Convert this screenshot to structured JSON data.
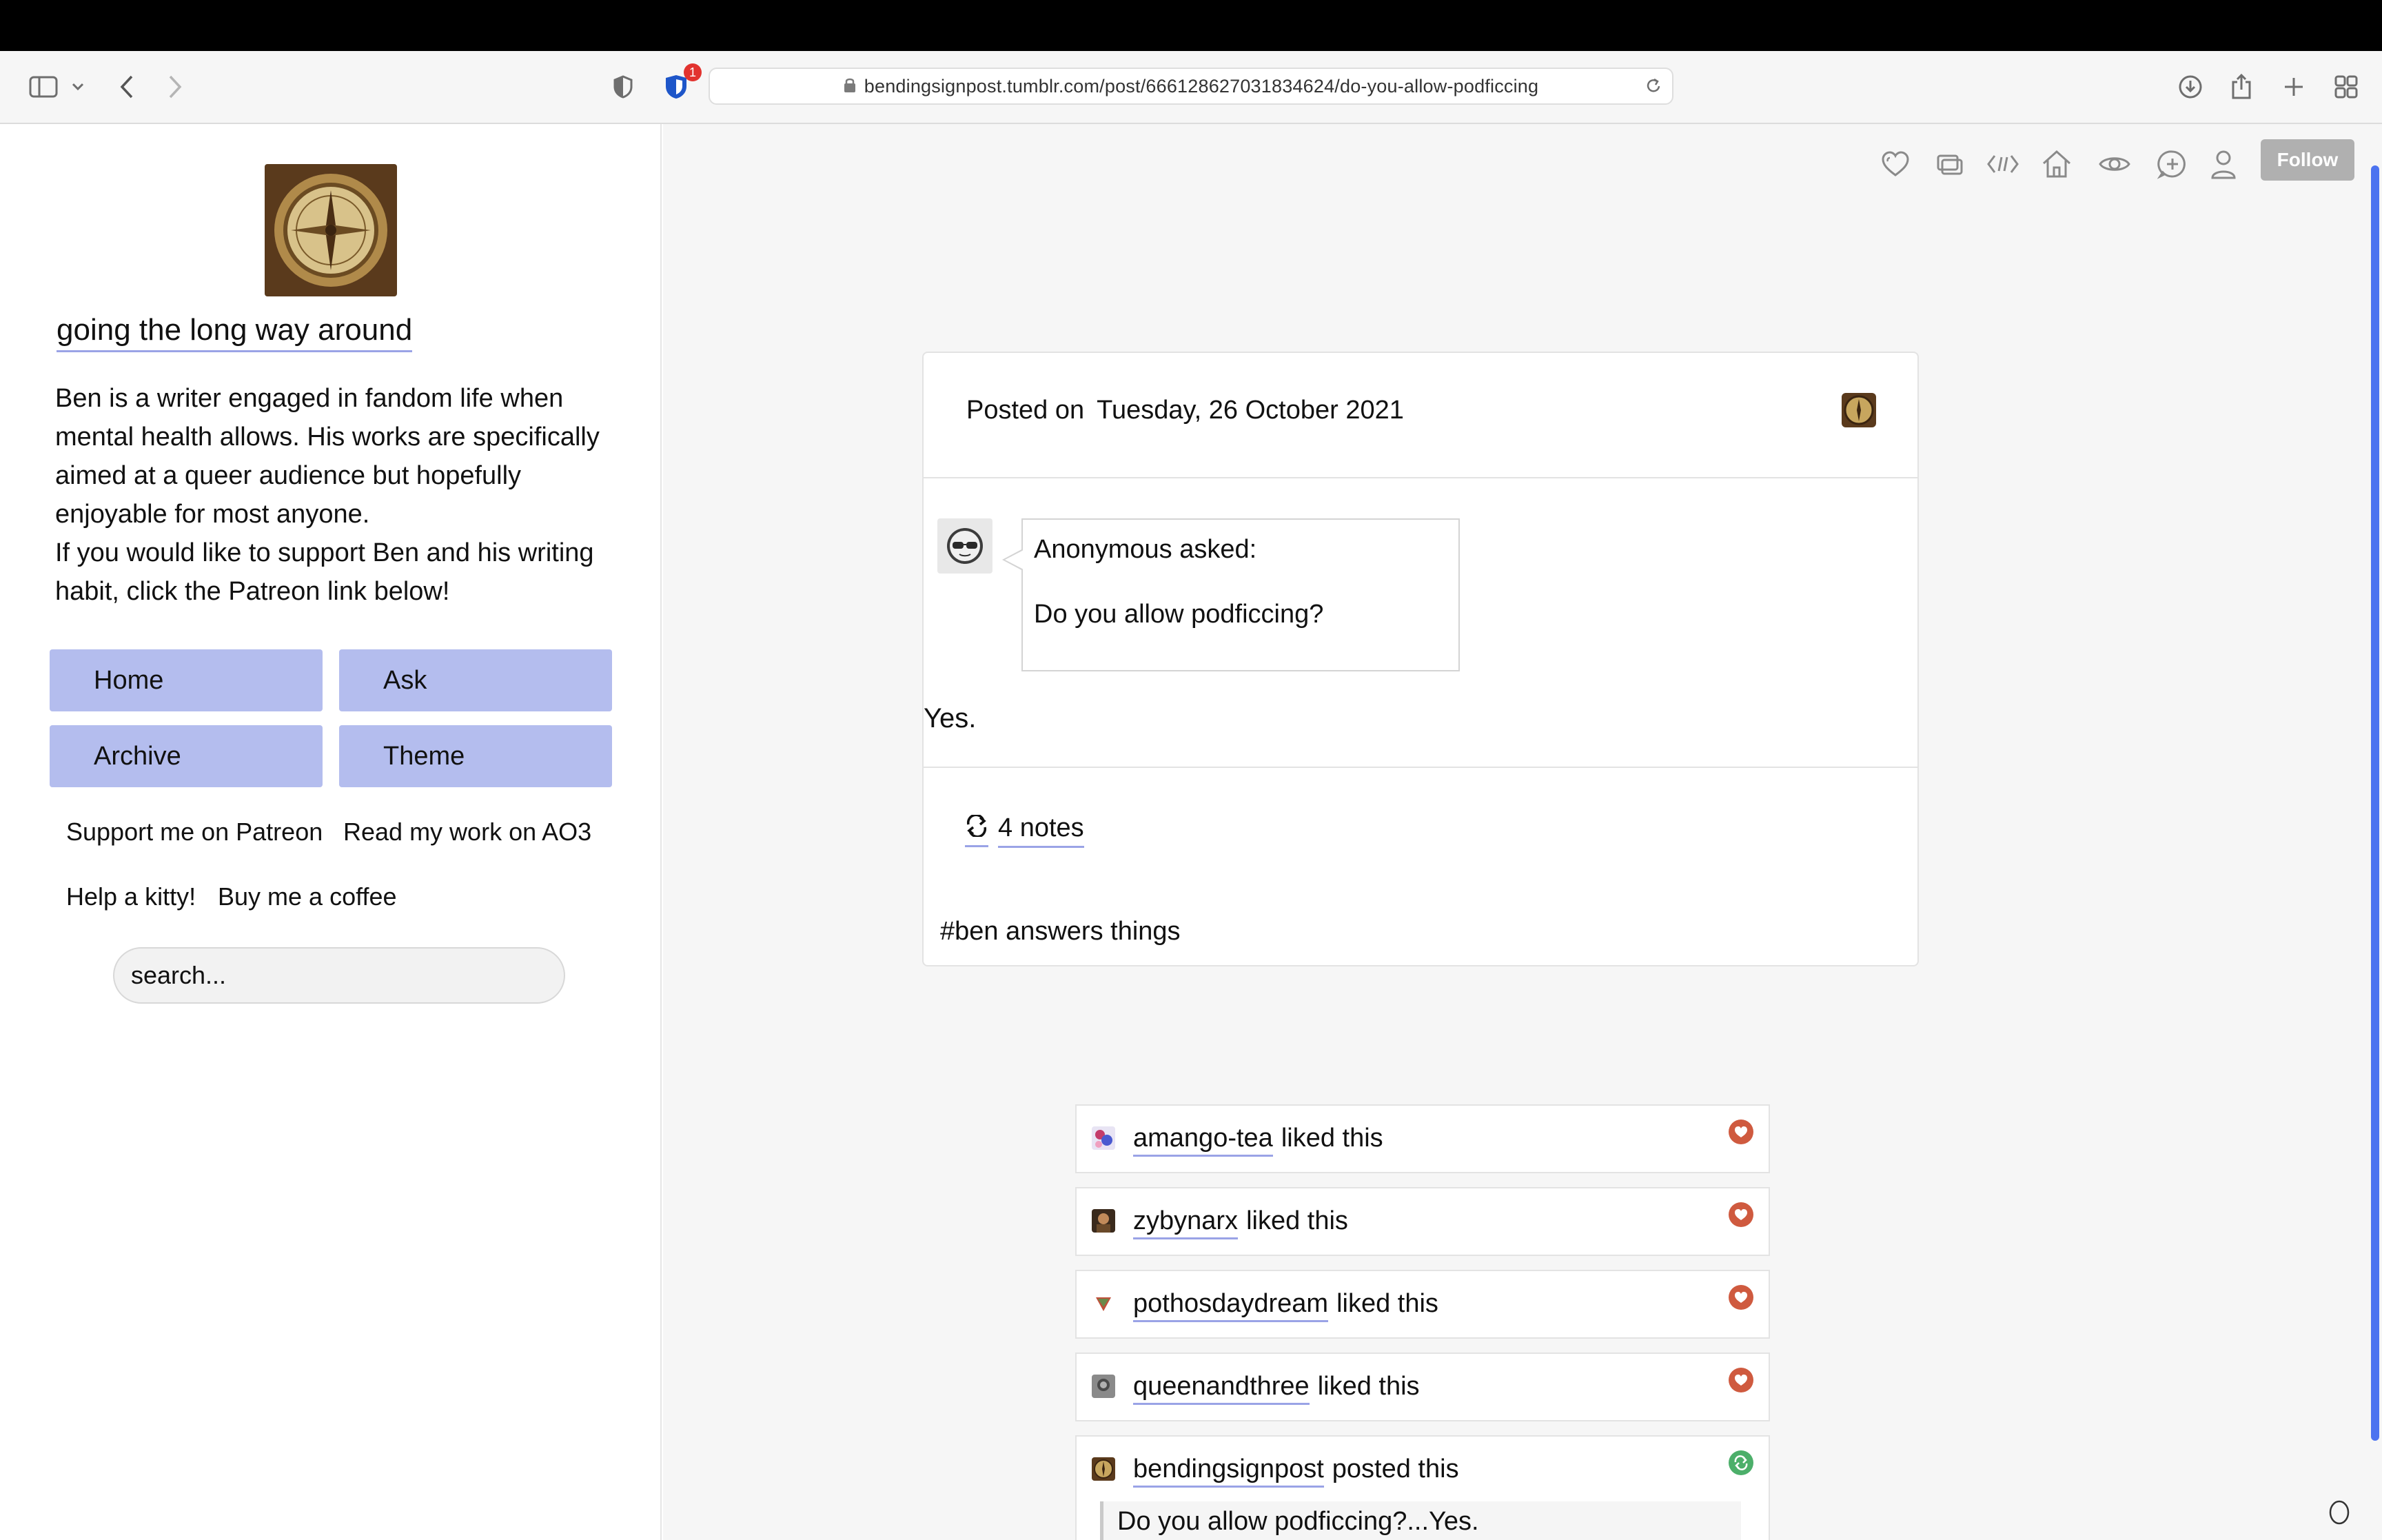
{
  "browser": {
    "url": "bendingsignpost.tumblr.com/post/666128627031834624/do-you-allow-podficcing",
    "extension_badge": "1"
  },
  "sidebar": {
    "blog_title": "going the long way around",
    "description": "Ben is a writer engaged in fandom life when mental health allows. His works are specifically aimed at a queer audience but hopefully enjoyable for most anyone.\nIf you would like to support Ben and his writing habit, click the Patreon link below!",
    "nav": {
      "home": "Home",
      "ask": "Ask",
      "archive": "Archive",
      "theme": "Theme"
    },
    "links": {
      "patreon": "Support me on Patreon",
      "ao3": "Read my work on AO3",
      "kitty": "Help a kitty!",
      "coffee": "Buy me a coffee"
    },
    "search_placeholder": "search..."
  },
  "controls": {
    "follow_label": "Follow"
  },
  "post": {
    "posted_on_label": "Posted on",
    "date": "Tuesday, 26 October 2021",
    "asker": "Anonymous asked:",
    "question": "Do you allow podficcing?",
    "answer": "Yes.",
    "notes_count": "4 notes",
    "tag": "#ben answers things"
  },
  "notes": [
    {
      "user": "amango-tea",
      "action": "liked this",
      "type": "like"
    },
    {
      "user": "zybynarx",
      "action": "liked this",
      "type": "like"
    },
    {
      "user": "pothosdaydream",
      "action": "liked this",
      "type": "like"
    },
    {
      "user": "queenandthree",
      "action": "liked this",
      "type": "like"
    },
    {
      "user": "bendingsignpost",
      "action": "posted this",
      "type": "post",
      "excerpt": "Do you allow podficcing?...Yes."
    }
  ],
  "colors": {
    "nav_button": "#b4bdee",
    "link_underline": "#9aa3e6",
    "like_badge": "#cf5a3f",
    "post_badge": "#4caf6a",
    "follow_button": "#b0b0b0"
  }
}
